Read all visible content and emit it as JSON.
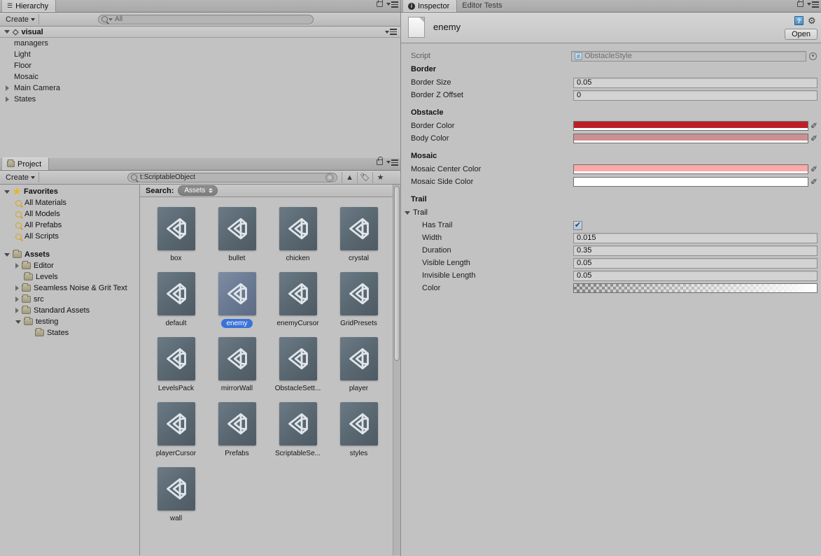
{
  "hierarchy": {
    "tab_label": "Hierarchy",
    "tab_icon": "hierarchy-icon",
    "create_label": "Create",
    "search_placeholder": "All",
    "scene_name": "visual",
    "items": [
      {
        "label": "managers",
        "expandable": false
      },
      {
        "label": "Light",
        "expandable": false
      },
      {
        "label": "Floor",
        "expandable": false
      },
      {
        "label": "Mosaic",
        "expandable": false
      },
      {
        "label": "Main Camera",
        "expandable": true
      },
      {
        "label": "States",
        "expandable": true
      }
    ]
  },
  "project": {
    "tab_label": "Project",
    "create_label": "Create",
    "search_value": "t:ScriptableObject",
    "search_label": "Search:",
    "scope_label": "Assets",
    "favorites": {
      "label": "Favorites",
      "items": [
        "All Materials",
        "All Models",
        "All Prefabs",
        "All Scripts"
      ]
    },
    "assets_tree": {
      "label": "Assets",
      "items": [
        {
          "label": "Editor",
          "expandable": true,
          "expanded": false,
          "indent": 1
        },
        {
          "label": "Levels",
          "expandable": false,
          "expanded": false,
          "indent": 1
        },
        {
          "label": "Seamless Noise & Grit Text",
          "expandable": true,
          "expanded": false,
          "indent": 1
        },
        {
          "label": "src",
          "expandable": true,
          "expanded": false,
          "indent": 1
        },
        {
          "label": "Standard Assets",
          "expandable": true,
          "expanded": false,
          "indent": 1
        },
        {
          "label": "testing",
          "expandable": true,
          "expanded": true,
          "indent": 1
        },
        {
          "label": "States",
          "expandable": false,
          "expanded": false,
          "indent": 2
        }
      ]
    },
    "assets": [
      {
        "name": "box",
        "selected": false
      },
      {
        "name": "bullet",
        "selected": false
      },
      {
        "name": "chicken",
        "selected": false
      },
      {
        "name": "crystal",
        "selected": false
      },
      {
        "name": "default",
        "selected": false
      },
      {
        "name": "enemy",
        "selected": true
      },
      {
        "name": "enemyCursor",
        "selected": false
      },
      {
        "name": "GridPresets",
        "selected": false
      },
      {
        "name": "LevelsPack",
        "selected": false
      },
      {
        "name": "mirrorWall",
        "selected": false
      },
      {
        "name": "ObstacleSett...",
        "selected": false
      },
      {
        "name": "player",
        "selected": false
      },
      {
        "name": "playerCursor",
        "selected": false
      },
      {
        "name": "Prefabs",
        "selected": false
      },
      {
        "name": "ScriptableSe...",
        "selected": false
      },
      {
        "name": "styles",
        "selected": false
      },
      {
        "name": "wall",
        "selected": false
      }
    ],
    "toolbar_icons": [
      "clear-search-icon",
      "type-filter-icon",
      "label-filter-icon",
      "favorite-filter-icon"
    ]
  },
  "inspector": {
    "tab_label": "Inspector",
    "tab_other_label": "Editor Tests",
    "object_name": "enemy",
    "open_button_label": "Open",
    "script": {
      "label": "Script",
      "value": "ObstacleStyle"
    },
    "sections": [
      {
        "header": "Border",
        "fields": [
          {
            "label": "Border Size",
            "value": "0.05",
            "type": "text"
          },
          {
            "label": "Border Z Offset",
            "value": "0",
            "type": "text"
          }
        ]
      },
      {
        "header": "Obstacle",
        "fields": [
          {
            "label": "Border Color",
            "value": "#BC2026",
            "type": "color"
          },
          {
            "label": "Body Color",
            "value": "#CC9093",
            "type": "color"
          }
        ]
      },
      {
        "header": "Mosaic",
        "fields": [
          {
            "label": "Mosaic Center Color",
            "value": "#FBA8A8",
            "type": "color"
          },
          {
            "label": "Mosaic Side Color",
            "value": "#FFFFFF",
            "type": "color"
          }
        ]
      },
      {
        "header": "Trail",
        "foldout_label": "Trail",
        "fields": [
          {
            "label": "Has Trail",
            "value": "checked",
            "type": "checkbox"
          },
          {
            "label": "Width",
            "value": "0.015",
            "type": "text"
          },
          {
            "label": "Duration",
            "value": "0.35",
            "type": "text"
          },
          {
            "label": "Visible Length",
            "value": "0.05",
            "type": "text"
          },
          {
            "label": "Invisible Length",
            "value": "0.05",
            "type": "text"
          },
          {
            "label": "Color",
            "value": "gradient-alpha",
            "type": "gradient"
          }
        ]
      }
    ]
  },
  "colors": {
    "panel_bg": "#c2c2c2",
    "selection_blue": "#3a72d8",
    "border_color": "#BC2026",
    "body_color": "#CC9093",
    "mosaic_center": "#FBA8A8",
    "mosaic_side": "#FFFFFF"
  }
}
